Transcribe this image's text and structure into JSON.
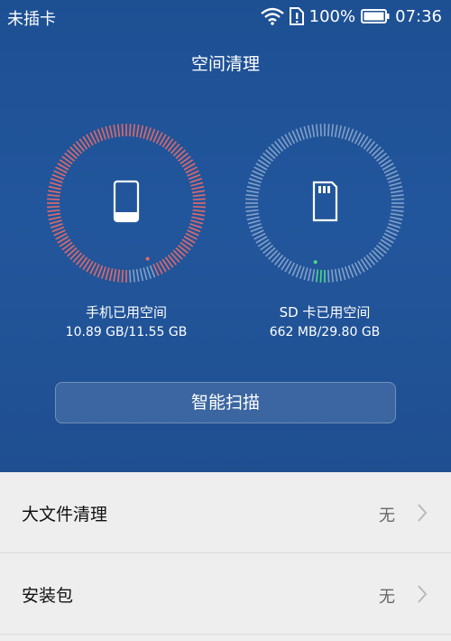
{
  "status_bar": {
    "carrier": "未插卡",
    "battery": "100%",
    "time": "07:36",
    "icons": [
      "wifi-icon",
      "sim-alert-icon",
      "battery-icon"
    ]
  },
  "header": {
    "title": "空间清理"
  },
  "phone_storage": {
    "label": "手机已用空间",
    "value": "10.89 GB/11.55 GB",
    "used_fraction": 0.943,
    "ring_color": "#e06a6a",
    "icon": "phone-icon"
  },
  "sd_storage": {
    "label": "SD 卡已用空间",
    "value": "662 MB/29.80 GB",
    "used_fraction": 0.022,
    "ring_color": "#4fd98a",
    "icon": "sd-card-icon"
  },
  "scan_button": {
    "label": "智能扫描"
  },
  "list": [
    {
      "label": "大文件清理",
      "status": "无"
    },
    {
      "label": "安装包",
      "status": "无"
    }
  ],
  "colors": {
    "background": "#22569c",
    "list_bg": "#eeeeee"
  }
}
